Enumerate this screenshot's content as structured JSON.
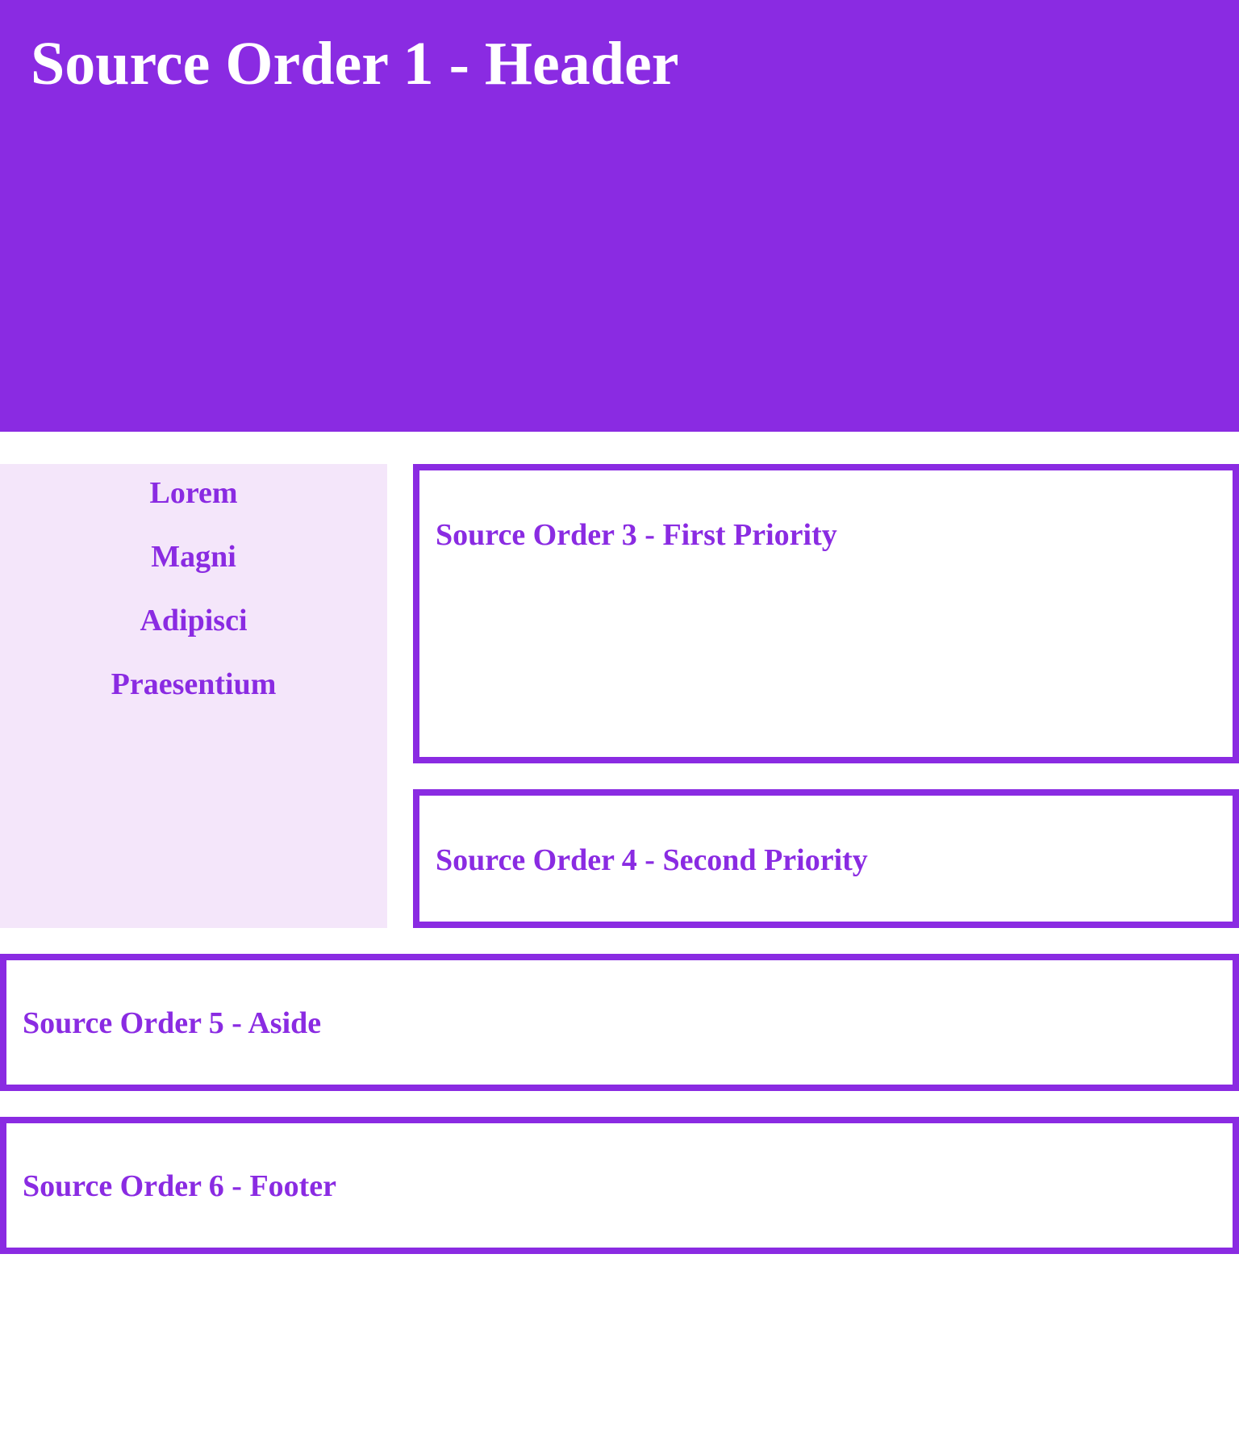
{
  "header": {
    "title": "Source Order 1 - Header"
  },
  "nav": {
    "items": [
      {
        "label": "Lorem"
      },
      {
        "label": "Magni"
      },
      {
        "label": "Adipisci"
      },
      {
        "label": "Praesentium"
      }
    ]
  },
  "main": {
    "first": {
      "title": "Source Order 3 - First Priority"
    },
    "second": {
      "title": "Source Order 4 - Second Priority"
    }
  },
  "aside": {
    "title": "Source Order 5 - Aside"
  },
  "footer": {
    "title": "Source Order 6 - Footer"
  },
  "colors": {
    "accent": "#8a2be2",
    "nav_background": "#f4e6fa",
    "header_text": "#ffffff"
  }
}
